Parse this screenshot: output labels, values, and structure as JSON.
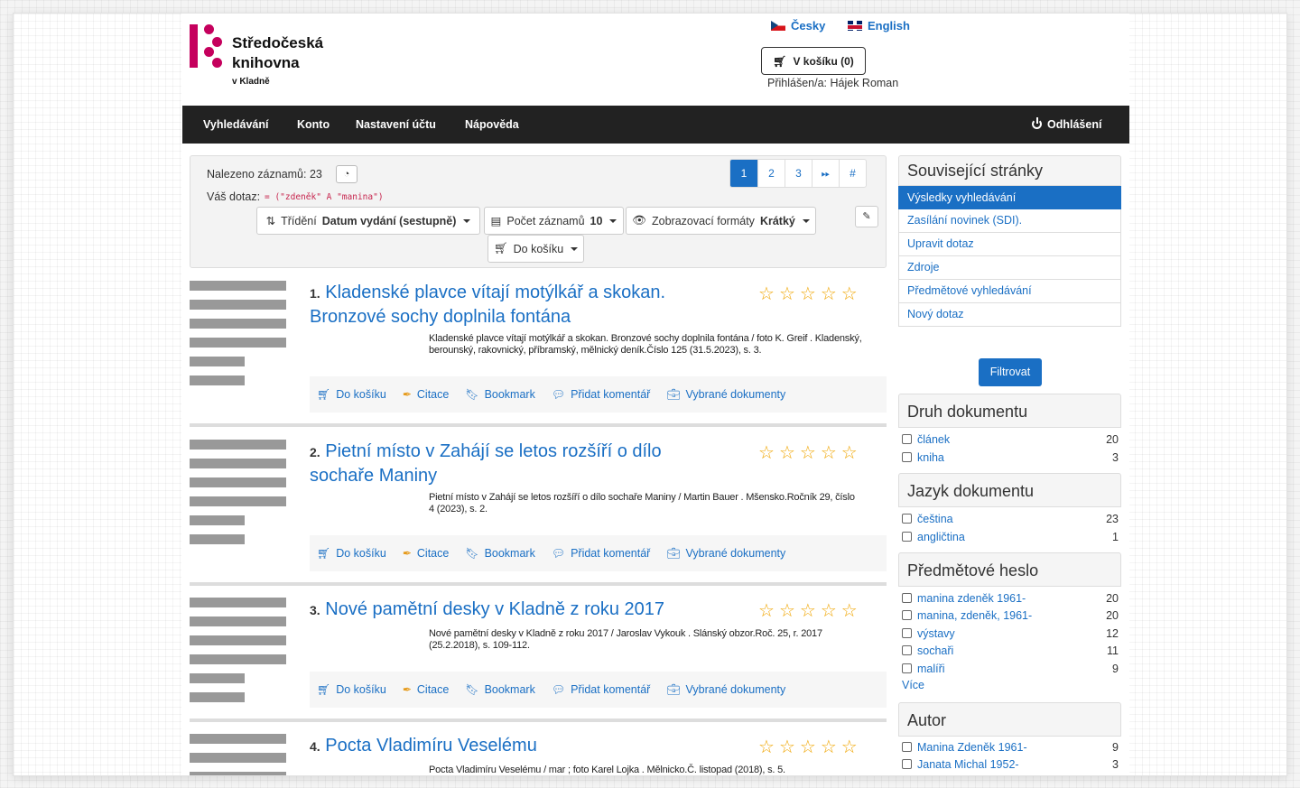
{
  "header": {
    "logo": {
      "line1": "Středočeská",
      "line2": "knihovna",
      "line3": "v Kladně"
    },
    "lang_czech": "Česky",
    "lang_english": "English",
    "cart_label": "V košíku (0)",
    "logged_in": "Přihlášen/a: Hájek Roman"
  },
  "nav": {
    "search": "Vyhledávání",
    "account": "Konto",
    "settings": "Nastavení účtu",
    "help": "Nápověda",
    "logout": "Odhlášení"
  },
  "results_toolbar": {
    "found_label": "Nalezeno záznamů: 23",
    "query_label": "Váš dotaz:",
    "query_value": "= (\"zdeněk\" A \"manina\")",
    "pages": [
      "1",
      "2",
      "3"
    ],
    "current_page": 1,
    "sort_label": "Třídění",
    "sort_value": "Datum vydání (sestupně)",
    "count_label": "Počet záznamů",
    "count_value": "10",
    "format_label": "Zobrazovací formáty",
    "format_value": "Krátký",
    "basket_label": "Do košíku"
  },
  "result_actions": {
    "add_to_cart": "Do košíku",
    "citation": "Citace",
    "bookmark": "Bookmark",
    "comment": "Přidat komentář",
    "selected": "Vybrané dokumenty"
  },
  "results": [
    {
      "num": "1.",
      "title": "Kladenské plavce vítají motýlkář a skokan. Bronzové sochy doplnila fontána",
      "desc": "Kladenské plavce vítají motýlkář a skokan. Bronzové sochy doplnila fontána / foto K. Greif . Kladenský, berounský, rakovnický, příbramský, mělnický deník.Číslo 125 (31.5.2023), s. 3.",
      "rating": 0
    },
    {
      "num": "2.",
      "title": "Pietní místo v Zahájí se letos rozšíří o dílo sochaře Maniny",
      "desc": "Pietní místo v Zahájí se letos rozšíří o dílo sochaře Maniny / Martin Bauer .  Mšensko.Ročník 29, číslo 4 (2023), s. 2.",
      "rating": 0
    },
    {
      "num": "3.",
      "title": "Nové pamětní desky v Kladně z roku 2017",
      "desc": "Nové pamětní desky v Kladně z roku 2017 / Jaroslav Vykouk .  Slánský obzor.Roč. 25, r. 2017 (25.2.2018), s. 109-112.",
      "rating": 0
    },
    {
      "num": "4.",
      "title": "Pocta Vladimíru Veselému",
      "desc": "Pocta Vladimíru Veselému / mar ; foto Karel Lojka .  Mělnicko.Č. listopad (2018), s. 5.",
      "rating": 0
    }
  ],
  "sidebar": {
    "related_title": "Související stránky",
    "related_links": [
      "Výsledky vyhledávání",
      "Zasílání novinek (SDI).",
      "Upravit dotaz",
      "Zdroje",
      "Předmětové vyhledávání",
      "Nový dotaz"
    ],
    "filter_button": "Filtrovat",
    "facets": [
      {
        "title": "Druh dokumentu",
        "items": [
          {
            "label": "článek",
            "count": "20"
          },
          {
            "label": "kniha",
            "count": "3"
          }
        ]
      },
      {
        "title": "Jazyk dokumentu",
        "items": [
          {
            "label": "čeština",
            "count": "23"
          },
          {
            "label": "angličtina",
            "count": "1"
          }
        ]
      },
      {
        "title": "Předmětové heslo",
        "items": [
          {
            "label": "manina zdeněk 1961-",
            "count": "20"
          },
          {
            "label": "manina, zdeněk, 1961-",
            "count": "20"
          },
          {
            "label": "výstavy",
            "count": "12"
          },
          {
            "label": "sochaři",
            "count": "11"
          },
          {
            "label": "malíři",
            "count": "9"
          }
        ],
        "more": "Více"
      },
      {
        "title": "Autor",
        "items": [
          {
            "label": "Manina Zdeněk 1961-",
            "count": "9"
          },
          {
            "label": "Janata Michal 1952-",
            "count": "3"
          }
        ]
      }
    ]
  },
  "colors": {
    "accent": "#1a6fc4",
    "brand": "#c5005d",
    "navbar": "#222222",
    "star": "#f0a500"
  }
}
